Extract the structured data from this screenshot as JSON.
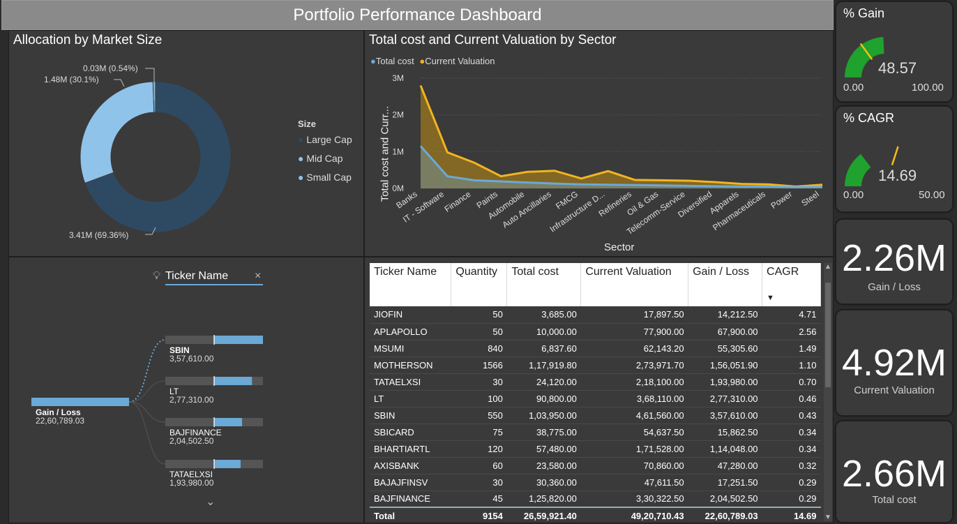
{
  "header": {
    "title": "Portfolio Performance Dashboard"
  },
  "allocation": {
    "title": "Allocation by Market Size",
    "legend_title": "Size",
    "legend": [
      {
        "name": "Large Cap",
        "color": "#2e4a63"
      },
      {
        "name": "Mid Cap",
        "color": "#8fc3ea"
      },
      {
        "name": "Small Cap",
        "color": "#6ba9d6"
      }
    ],
    "labels": [
      "3.41M (69.36%)",
      "1.48M (30.1%)",
      "0.03M (0.54%)"
    ]
  },
  "sector_chart": {
    "title": "Total cost and Current Valuation by Sector",
    "legend": [
      {
        "name": "Total cost",
        "color": "#6ba9d6"
      },
      {
        "name": "Current Valuation",
        "color": "#f2b51f"
      }
    ],
    "ylabel": "Total cost and Curr...",
    "xlabel": "Sector",
    "yticks": [
      "0M",
      "1M",
      "2M",
      "3M"
    ]
  },
  "decomp": {
    "field_label": "Ticker Name",
    "root_label": "Gain / Loss",
    "root_value": "22,60,789.03",
    "nodes": [
      {
        "label": "SBIN",
        "value": "3,57,610.00",
        "fraction": 1.0
      },
      {
        "label": "LT",
        "value": "2,77,310.00",
        "fraction": 0.775
      },
      {
        "label": "BAJFINANCE",
        "value": "2,04,502.50",
        "fraction": 0.572
      },
      {
        "label": "TATAELXSI",
        "value": "1,93,980.00",
        "fraction": 0.542
      }
    ]
  },
  "table": {
    "headers": [
      "Ticker Name",
      "Quantity",
      "Total cost",
      "Current Valuation",
      "Gain / Loss",
      "CAGR"
    ],
    "rows": [
      [
        "JIOFIN",
        "50",
        "3,685.00",
        "17,897.50",
        "14,212.50",
        "4.71"
      ],
      [
        "APLAPOLLO",
        "50",
        "10,000.00",
        "77,900.00",
        "67,900.00",
        "2.56"
      ],
      [
        "MSUMI",
        "840",
        "6,837.60",
        "62,143.20",
        "55,305.60",
        "1.49"
      ],
      [
        "MOTHERSON",
        "1566",
        "1,17,919.80",
        "2,73,971.70",
        "1,56,051.90",
        "1.10"
      ],
      [
        "TATAELXSI",
        "30",
        "24,120.00",
        "2,18,100.00",
        "1,93,980.00",
        "0.70"
      ],
      [
        "LT",
        "100",
        "90,800.00",
        "3,68,110.00",
        "2,77,310.00",
        "0.46"
      ],
      [
        "SBIN",
        "550",
        "1,03,950.00",
        "4,61,560.00",
        "3,57,610.00",
        "0.43"
      ],
      [
        "SBICARD",
        "75",
        "38,775.00",
        "54,637.50",
        "15,862.50",
        "0.34"
      ],
      [
        "BHARTIARTL",
        "120",
        "57,480.00",
        "1,71,528.00",
        "1,14,048.00",
        "0.34"
      ],
      [
        "AXISBANK",
        "60",
        "23,580.00",
        "70,860.00",
        "47,280.00",
        "0.32"
      ],
      [
        "BAJAJFINSV",
        "30",
        "30,360.00",
        "47,611.50",
        "17,251.50",
        "0.29"
      ],
      [
        "BAJFINANCE",
        "45",
        "1,25,820.00",
        "3,30,322.50",
        "2,04,502.50",
        "0.29"
      ]
    ],
    "total": [
      "Total",
      "9154",
      "26,59,921.40",
      "49,20,710.43",
      "22,60,789.03",
      "14.69"
    ]
  },
  "gauges": [
    {
      "title": "% Gain",
      "value": "48.57",
      "min": "0.00",
      "max": "100.00",
      "value_num": 48.57,
      "max_num": 100,
      "target_frac": 0.3
    },
    {
      "title": "% CAGR",
      "value": "14.69",
      "min": "0.00",
      "max": "50.00",
      "value_num": 14.69,
      "max_num": 50,
      "target_frac": 0.6
    }
  ],
  "kpis": [
    {
      "value": "2.26M",
      "label": "Gain / Loss"
    },
    {
      "value": "4.92M",
      "label": "Current Valuation"
    },
    {
      "value": "2.66M",
      "label": "Total cost"
    }
  ],
  "chart_data": [
    {
      "type": "pie",
      "title": "Allocation by Market Size",
      "categories": [
        "Large Cap",
        "Mid Cap",
        "Small Cap"
      ],
      "values": [
        69.36,
        30.1,
        0.54
      ],
      "colors": [
        "#2e4a63",
        "#8fc3ea",
        "#6ba9d6"
      ]
    },
    {
      "type": "area",
      "title": "Total cost and Current Valuation by Sector",
      "xlabel": "Sector",
      "ylabel": "Total cost and Curr...",
      "ylim": [
        0,
        3
      ],
      "categories": [
        "Banks",
        "IT - Software",
        "Finance",
        "Paints",
        "Automobile",
        "Auto Ancillaries",
        "FMCG",
        "Infrastructure D...",
        "Refineries",
        "Oil & Gas",
        "Telecomm-Service",
        "Diversified",
        "Apparels",
        "Pharmaceuticals",
        "Power",
        "Steel"
      ],
      "series": [
        {
          "name": "Total cost",
          "values": [
            1.15,
            0.33,
            0.22,
            0.19,
            0.16,
            0.13,
            0.11,
            0.1,
            0.09,
            0.08,
            0.07,
            0.06,
            0.05,
            0.05,
            0.03,
            0.04
          ]
        },
        {
          "name": "Current Valuation",
          "values": [
            2.8,
            0.98,
            0.7,
            0.33,
            0.45,
            0.48,
            0.27,
            0.47,
            0.23,
            0.22,
            0.21,
            0.17,
            0.12,
            0.11,
            0.05,
            0.1
          ]
        }
      ]
    }
  ]
}
